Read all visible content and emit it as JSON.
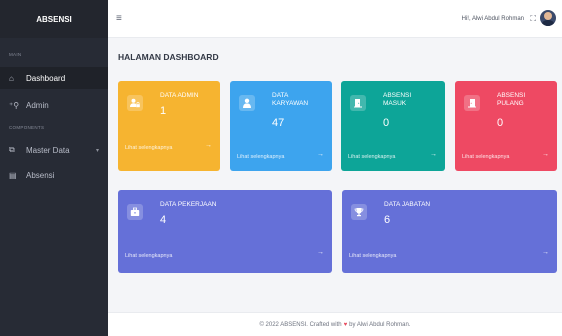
{
  "sidebar": {
    "brand": "ABSENSI",
    "section_main": "MAIN",
    "section_components": "COMPONENTS",
    "items": [
      {
        "label": "Dashboard",
        "icon": "home-icon",
        "active": true
      },
      {
        "label": "Admin",
        "icon": "user-plus-icon"
      },
      {
        "label": "Master Data",
        "icon": "copy-icon"
      },
      {
        "label": "Absensi",
        "icon": "calendar-icon"
      }
    ]
  },
  "topbar": {
    "menu_icon": "hamburger-icon",
    "greeting": "Hi!, Alwi Abdul Rohman",
    "fullscreen_icon": "fullscreen-icon"
  },
  "page": {
    "title": "HALAMAN DASHBOARD"
  },
  "cards": {
    "admin": {
      "label": "DATA ADMIN",
      "value": "1",
      "more": "Lihat selengkapnya",
      "color": "#f6b430",
      "icon": "user-lock-icon"
    },
    "karyawan": {
      "label_1": "DATA",
      "label_2": "KARYAWAN",
      "value": "47",
      "more": "Lihat selengkapnya",
      "color": "#3da4ee",
      "icon": "user-icon"
    },
    "masuk": {
      "label_1": "ABSENSI",
      "label_2": "MASUK",
      "value": "0",
      "more": "Lihat selengkapnya",
      "color": "#0da598",
      "icon": "door-in-icon"
    },
    "pulang": {
      "label_1": "ABSENSI",
      "label_2": "PULANG",
      "value": "0",
      "more": "Lihat selengkapnya",
      "color": "#ee4963",
      "icon": "door-out-icon"
    },
    "pekerjaan": {
      "label": "DATA PEKERJAAN",
      "value": "4",
      "more": "Lihat selengkapnya",
      "color": "#6570d8",
      "icon": "briefcase-icon"
    },
    "jabatan": {
      "label": "DATA JABATAN",
      "value": "6",
      "more": "Lihat selengkapnya",
      "color": "#6570d8",
      "icon": "trophy-icon"
    }
  },
  "footer": {
    "prefix": "© 2022 ABSENSI. Crafted with",
    "suffix": "by Alwi Abdul Rohman."
  }
}
